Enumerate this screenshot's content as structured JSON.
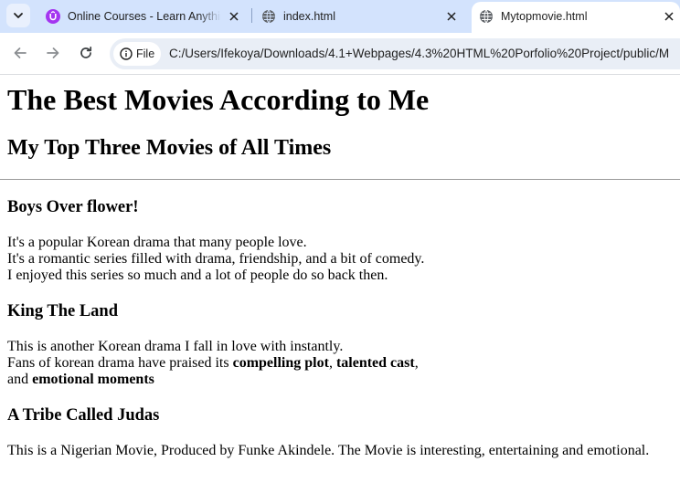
{
  "browser": {
    "tabs": [
      {
        "title": "Online Courses - Learn Anything",
        "favicon": "udemy-logo-icon",
        "active": false
      },
      {
        "title": "index.html",
        "favicon": "globe-icon",
        "active": false
      },
      {
        "title": "Mytopmovie.html",
        "favicon": "globe-icon",
        "active": true
      }
    ],
    "address_bar": {
      "security_chip_label": "File",
      "url": "C:/Users/Ifekoya/Downloads/4.1+Webpages/4.3%20HTML%20Porfolio%20Project/public/M"
    },
    "colors": {
      "tabstrip": "#d3e3fd",
      "omnibox": "#e9eef6",
      "udemy_purple": "#a435f0"
    }
  },
  "page": {
    "title": "The Best Movies According to Me",
    "subtitle": "My Top Three Movies of All Times",
    "movies": [
      {
        "name": "Boys Over flower!",
        "lines": [
          "It's a popular Korean drama that many people love.",
          "It's a romantic series filled with drama, friendship, and a bit of comedy.",
          "I enjoyed this series so much and a lot of people do so back then."
        ]
      },
      {
        "name": "King The Land",
        "line1": "This is another Korean drama I fall in love with instantly.",
        "line2_prefix": "Fans of korean drama have praised its ",
        "bold1": "compelling plot",
        "sep1": ", ",
        "bold2": "talented cast",
        "sep2": ",",
        "line3_prefix": "and ",
        "bold3": "emotional moments"
      },
      {
        "name": "A Tribe Called Judas",
        "line1": "This is a Nigerian Movie, Produced by Funke Akindele. The Movie is interesting, entertaining and emotional."
      }
    ]
  }
}
